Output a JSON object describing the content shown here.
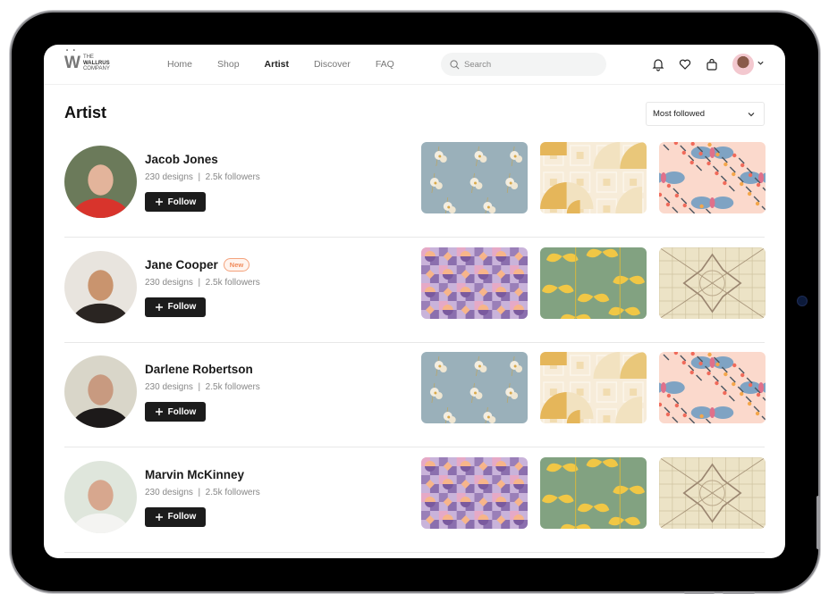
{
  "brand": {
    "logo_mark": "W",
    "line1": "THE",
    "line2": "WALLRUS",
    "line3": "COMPANY"
  },
  "nav": {
    "links": [
      {
        "label": "Home",
        "active": false
      },
      {
        "label": "Shop",
        "active": false
      },
      {
        "label": "Artist",
        "active": true
      },
      {
        "label": "Discover",
        "active": false
      },
      {
        "label": "FAQ",
        "active": false
      }
    ],
    "search_placeholder": "Search",
    "icons": [
      "bell-icon",
      "heart-icon",
      "shopping-bag-icon",
      "user-avatar",
      "chevron-down-icon"
    ]
  },
  "page": {
    "title": "Artist",
    "sort": {
      "selected": "Most followed"
    }
  },
  "artists": [
    {
      "name": "Jacob Jones",
      "badge": null,
      "designs": "230 designs",
      "followers": "2.5k followers",
      "separator": "|",
      "follow_label": "Follow",
      "photo_colors": [
        "#6b7a5a",
        "#d8342c",
        "#e3b49b"
      ],
      "patterns": [
        "floral-blue",
        "geometric-gold",
        "butterfly-peach"
      ]
    },
    {
      "name": "Jane Cooper",
      "badge": "New",
      "designs": "230 designs",
      "followers": "2.5k followers",
      "separator": "|",
      "follow_label": "Follow",
      "photo_colors": [
        "#e8e4de",
        "#2a2522",
        "#c9946e"
      ],
      "patterns": [
        "geometric-purple",
        "leaf-green",
        "tile-beige"
      ]
    },
    {
      "name": "Darlene Robertson",
      "badge": null,
      "designs": "230 designs",
      "followers": "2.5k followers",
      "separator": "|",
      "follow_label": "Follow",
      "photo_colors": [
        "#d9d6c9",
        "#1d1a1a",
        "#c89a80"
      ],
      "patterns": [
        "floral-blue",
        "geometric-gold",
        "butterfly-peach"
      ]
    },
    {
      "name": "Marvin McKinney",
      "badge": null,
      "designs": "230 designs",
      "followers": "2.5k followers",
      "separator": "|",
      "follow_label": "Follow",
      "photo_colors": [
        "#dfe6dc",
        "#f4f4f2",
        "#d7a78e"
      ],
      "patterns": [
        "geometric-purple",
        "leaf-green",
        "tile-beige"
      ]
    }
  ],
  "colors": {
    "accent_badge": "#f08a5a",
    "button_bg": "#1c1c1c",
    "text_primary": "#1a1a1a",
    "text_muted": "#888888"
  }
}
